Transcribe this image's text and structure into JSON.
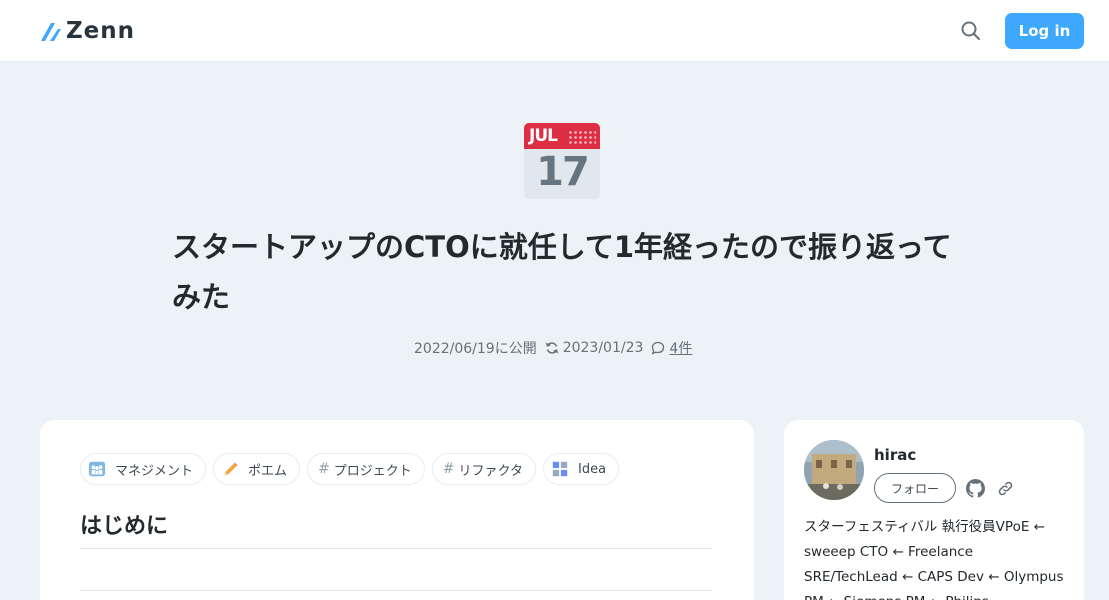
{
  "header": {
    "logo_text": "Zenn",
    "brand_color": "#3ea8ff",
    "search_icon": "search-icon",
    "login_label": "Log in"
  },
  "article": {
    "emoji": {
      "name": "calendar-icon",
      "month": "JUL",
      "day": "17"
    },
    "title": "スタートアップのCTOに就任して1年経ったので振り返ってみた",
    "published": "2022/06/19に公開",
    "updated": "2023/01/23",
    "comments": "4件",
    "tags": [
      {
        "icon": "👨‍👩‍👧",
        "icon_name": "team-icon",
        "label": "マネジメント"
      },
      {
        "icon": "✏️",
        "icon_name": "pencil-icon",
        "label": "ポエム"
      },
      {
        "icon": "#",
        "icon_name": "hash-icon",
        "label": "プロジェクト"
      },
      {
        "icon": "#",
        "icon_name": "hash-icon",
        "label": "リファクタ"
      },
      {
        "icon": "",
        "icon_name": "idea-grid-icon",
        "label": "Idea"
      }
    ],
    "heading": "はじめに"
  },
  "profile": {
    "username": "hirac",
    "follow_label": "フォロー",
    "bio": "スターフェスティバル 執行役員VPoE ← sweeep CTO ← Freelance SRE/TechLead ← CAPS Dev ← Olympus PM ← Siemens PM ← Philips"
  }
}
